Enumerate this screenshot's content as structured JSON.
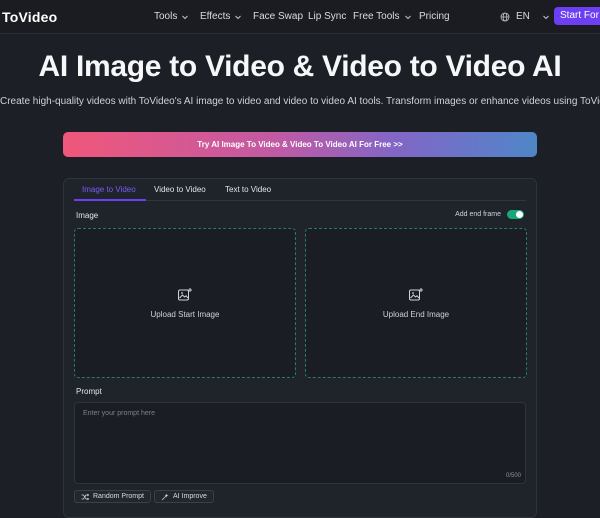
{
  "brand": {
    "name": "ToVideo"
  },
  "nav": {
    "items": [
      {
        "label": "Tools",
        "has_dropdown": true
      },
      {
        "label": "Effects",
        "has_dropdown": true
      },
      {
        "label": "Face Swap",
        "has_dropdown": false
      },
      {
        "label": "Lip Sync",
        "has_dropdown": false
      },
      {
        "label": "Free Tools",
        "has_dropdown": true
      },
      {
        "label": "Pricing",
        "has_dropdown": false
      }
    ],
    "language": "EN",
    "start_button": "Start For Free"
  },
  "hero": {
    "title": "AI Image to Video & Video to Video AI",
    "subtitle": "Create high-quality videos with ToVideo's AI image to video and video to video AI tools. Transform images or enhance videos using ToVideo",
    "cta": "Try AI Image To Video & Video To Video AI For Free >>"
  },
  "panel": {
    "tabs": [
      {
        "label": "Image to Video",
        "active": true
      },
      {
        "label": "Video to Video",
        "active": false
      },
      {
        "label": "Text to Video",
        "active": false
      }
    ],
    "image_label": "Image",
    "add_end_frame_label": "Add end frame",
    "add_end_frame_enabled": true,
    "upload_start_label": "Upload Start Image",
    "upload_end_label": "Upload End Image",
    "prompt_label": "Prompt",
    "prompt_placeholder": "Enter your prompt here",
    "prompt_value": "",
    "char_counter": "0/500",
    "random_prompt_label": "Random Prompt",
    "ai_improve_label": "AI Improve"
  },
  "colors": {
    "background": "#1c1f25",
    "accent": "#6d3ff2",
    "toggle_on": "#19a87a",
    "dashed_border": "#2b7a66"
  },
  "icons": [
    "chevron-down-icon",
    "globe-icon",
    "image-add-icon",
    "shuffle-icon",
    "sparkle-icon"
  ]
}
